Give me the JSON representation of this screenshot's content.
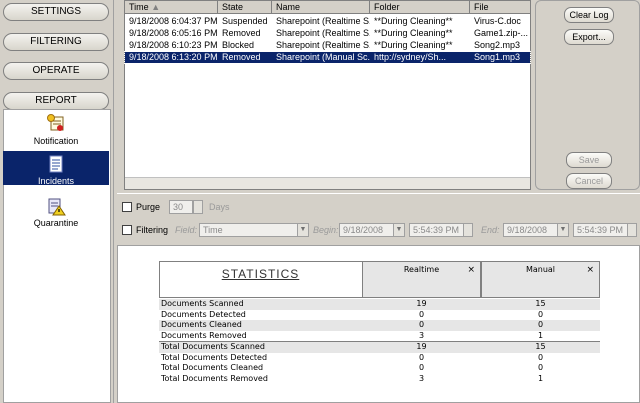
{
  "nav": {
    "buttons": [
      "SETTINGS",
      "FILTERING",
      "OPERATE",
      "REPORT"
    ],
    "items": [
      {
        "label": "Notification",
        "icon": "notification-icon"
      },
      {
        "label": "Incidents",
        "icon": "incidents-icon",
        "selected": true
      },
      {
        "label": "Quarantine",
        "icon": "quarantine-icon"
      }
    ]
  },
  "list": {
    "columns": [
      "Time",
      "State",
      "Name",
      "Folder",
      "File"
    ],
    "rows": [
      {
        "time": "9/18/2008 6:04:37 PM",
        "state": "Suspended",
        "name": "Sharepoint (Realtime S...",
        "folder": "**During Cleaning**",
        "file": "Virus-C.doc"
      },
      {
        "time": "9/18/2008 6:05:16 PM",
        "state": "Removed",
        "name": "Sharepoint (Realtime S...",
        "folder": "**During Cleaning**",
        "file": "Game1.zip-..."
      },
      {
        "time": "9/18/2008 6:10:23 PM",
        "state": "Blocked",
        "name": "Sharepoint (Realtime S...",
        "folder": "**During Cleaning**",
        "file": "Song2.mp3"
      },
      {
        "time": "9/18/2008 6:13:20 PM",
        "state": "Removed",
        "name": "Sharepoint (Manual Sc...",
        "folder": "http://sydney/Sh...",
        "file": "Song1.mp3",
        "selected": true
      }
    ]
  },
  "buttons": {
    "clear_log": "Clear Log",
    "export": "Export...",
    "save": "Save",
    "cancel": "Cancel"
  },
  "controls": {
    "purge_label": "Purge",
    "purge_value": "30",
    "days_label": "Days",
    "filtering_label": "Filtering",
    "field_label": "Field:",
    "field_value": "Time",
    "begin_label": "Begin:",
    "begin_date": "9/18/2008",
    "begin_time": "5:54:39 PM",
    "end_label": "End:",
    "end_date": "9/18/2008",
    "end_time": "5:54:39 PM"
  },
  "statistics": {
    "title": "STATISTICS",
    "col_realtime": "Realtime",
    "col_manual": "Manual",
    "rows": [
      {
        "name": "Documents Scanned",
        "realtime": "19",
        "manual": "15"
      },
      {
        "name": "Documents Detected",
        "realtime": "0",
        "manual": "0"
      },
      {
        "name": "Documents Cleaned",
        "realtime": "0",
        "manual": "0"
      },
      {
        "name": "Documents Removed",
        "realtime": "3",
        "manual": "1"
      },
      {
        "name": "Total Documents Scanned",
        "realtime": "19",
        "manual": "15"
      },
      {
        "name": "Total Documents Detected",
        "realtime": "0",
        "manual": "0"
      },
      {
        "name": "Total Documents Cleaned",
        "realtime": "0",
        "manual": "0"
      },
      {
        "name": "Total Documents  Removed",
        "realtime": "3",
        "manual": "1"
      }
    ]
  }
}
